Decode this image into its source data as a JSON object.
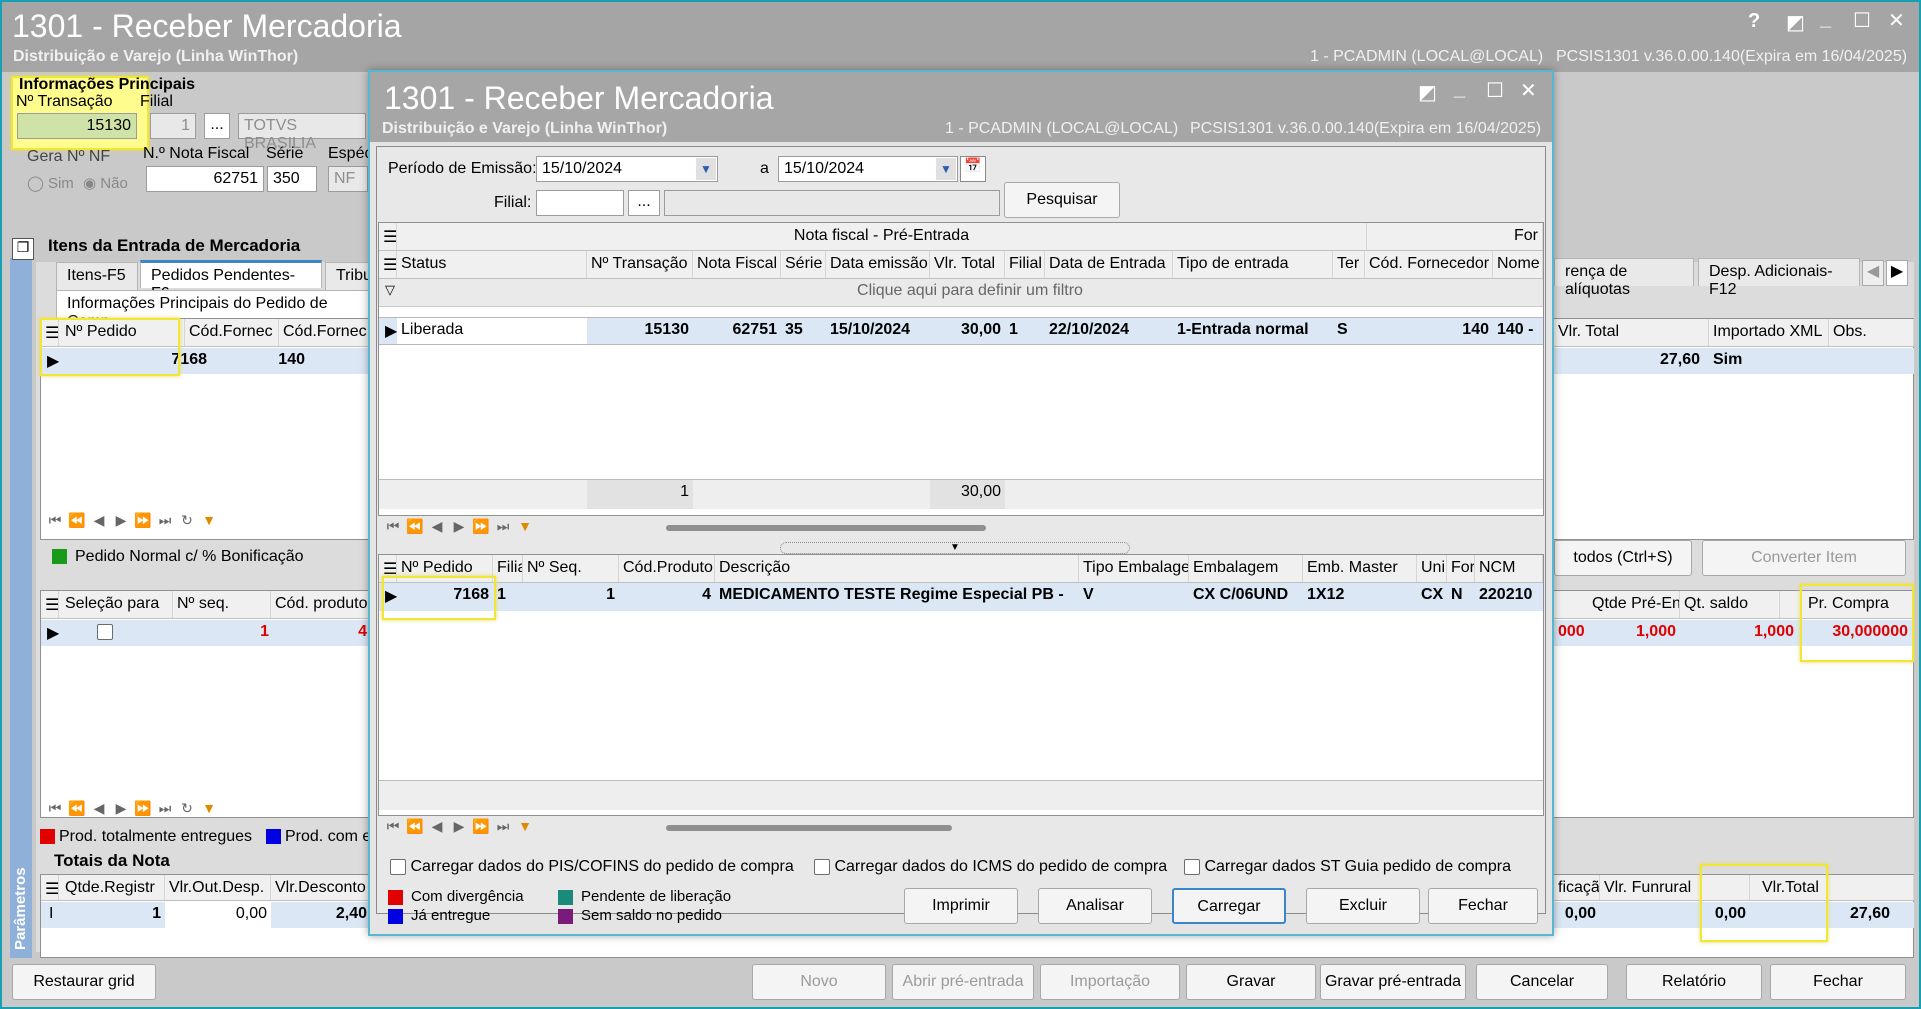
{
  "colors": {
    "highlight": "#fffc8e",
    "accent": "#57b7cf",
    "title_bg": "#a6a6a6",
    "selected_row": "#dbe7f5",
    "legend_divergence": "#e00000",
    "legend_delivered": "#0000e0",
    "legend_pending": "#1a8a7a",
    "legend_no_balance": "#7a1a7a",
    "legend_normal_bonus": "#1a9a1a"
  },
  "bg": {
    "title": "1301 - Receber Mercadoria",
    "subtitle": "Distribuição e Varejo (Linha WinThor)",
    "user_info": "1 - PCADMIN (LOCAL@LOCAL)",
    "version_info": "PCSIS1301  v.36.0.00.140(Expira em 16/04/2025)",
    "ctrl_help": "?",
    "ctrl_min": "_",
    "ctrl_max": "☐",
    "ctrl_close": "✕",
    "info_section": {
      "title": "Informações Principais",
      "label_transacao": "Nº Transação",
      "label_filial": "Filial",
      "value_transacao": "15130",
      "value_filial": "1",
      "value_filial_name": "TOTVS BRASILIA",
      "label_gera_nf": "Gera Nº NF",
      "label_sim": "Sim",
      "label_nao": "Não",
      "label_nota_fiscal": "N.º Nota Fiscal",
      "label_serie": "Série",
      "label_especie": "Espéc",
      "value_nota_fiscal": "62751",
      "value_serie": "350",
      "value_especie": "NF",
      "browse": "..."
    },
    "items_title": "Itens da Entrada de Mercadoria",
    "tabs": [
      "Itens-F5",
      "Pedidos Pendentes-F6",
      "Tribu",
      "rença de alíquotas",
      "Desp. Adicionais-F12"
    ],
    "subtab": "Informações Principais do Pedido de Comp",
    "pedido_grid": {
      "headers": [
        "Nº Pedido",
        "Cód.Fornec",
        "Cód.Fornec.P"
      ],
      "row": [
        "7168",
        "140",
        ""
      ],
      "right_headers": [
        "Vlr. Total",
        "Importado XML",
        "Obs."
      ],
      "right_row": [
        "27,60",
        "Sim",
        ""
      ]
    },
    "legend_normal": "Pedido Normal c/ % Bonificação",
    "btn_select_all": "todos (Ctrl+S)",
    "btn_convert": "Converter Item",
    "items_grid": {
      "headers": [
        "Seleção para",
        "Nº seq.",
        "Cód. produto"
      ],
      "row_seq": "1",
      "row_prod": "4",
      "right_headers": [
        "Qtde Pré-En",
        "Qt. saldo",
        "Pr. Compra"
      ],
      "right_row": [
        "000",
        "1,000",
        "1,000",
        "30,000000"
      ]
    },
    "legend_delivered_total": "Prod. totalmente entregues",
    "legend_prod_com": "Prod. com e",
    "totals_title": "Totais da Nota",
    "totals_headers": [
      "Qtde.Registr",
      "Vlr.Out.Desp.",
      "Vlr.Desconto"
    ],
    "totals_row": [
      "1",
      "0,00",
      "2,40"
    ],
    "totals_right_headers": [
      "ficaçã",
      "Vlr. Funrural",
      "Vlr.Total"
    ],
    "totals_right_row": [
      "0,00",
      "0,00",
      "27,60"
    ],
    "side_label": "Parâmetros",
    "bottom_buttons": {
      "restaurar": "Restaurar grid",
      "novo": "Novo",
      "abrir": "Abrir pré-entrada",
      "importacao": "Importação",
      "gravar": "Gravar",
      "gravar_pre": "Gravar pré-entrada",
      "cancelar": "Cancelar",
      "relatorio": "Relatório",
      "fechar": "Fechar"
    }
  },
  "modal": {
    "title": "1301 - Receber Mercadoria",
    "subtitle": "Distribuição e Varejo (Linha WinThor)",
    "user_info": "1 - PCADMIN (LOCAL@LOCAL)",
    "version_info": "PCSIS1301  v.36.0.00.140(Expira em 16/04/2025)",
    "ctrl_min": "_",
    "ctrl_max": "☐",
    "ctrl_close": "✕",
    "periodo_label": "Período de Emissão:",
    "date_from": "15/10/2024",
    "date_sep": "a",
    "date_to": "15/10/2024",
    "filial_label": "Filial:",
    "browse": "...",
    "pesquisar": "Pesquisar",
    "band_main": "Nota fiscal - Pré-Entrada",
    "band_right": "For",
    "nf_headers": [
      "Status",
      "Nº Transação",
      "Nota Fiscal",
      "Série",
      "Data emissão",
      "Vlr. Total",
      "Filial",
      "Data de Entrada",
      "Tipo de entrada",
      "Ter",
      "Cód. Fornecedor",
      "Nome F"
    ],
    "filter_text": "Clique aqui para definir um filtro",
    "nf_row": [
      "Liberada",
      "15130",
      "62751",
      "35",
      "15/10/2024",
      "30,00",
      "1",
      "22/10/2024",
      "1-Entrada normal",
      "S",
      "140",
      "140 -"
    ],
    "nf_footer_count": "1",
    "nf_footer_total": "30,00",
    "item_headers": [
      "Nº Pedido",
      "Filia",
      "Nº Seq.",
      "Cód.Produto",
      "Descrição",
      "Tipo Embalage",
      "Embalagem",
      "Emb. Master",
      "Uni",
      "For",
      "NCM"
    ],
    "item_row": [
      "7168",
      "1",
      "1",
      "4",
      "MEDICAMENTO TESTE Regime Especial PB -",
      "V",
      "CX C/06UND",
      "1X12",
      "CX",
      "N",
      "220210"
    ],
    "chk_pis": "Carregar dados do PIS/COFINS do pedido de compra",
    "chk_icms": "Carregar dados do ICMS do pedido de compra",
    "chk_st": "Carregar dados ST Guia pedido de compra",
    "legend": {
      "divergence": "Com divergência",
      "delivered": "Já entregue",
      "pending": "Pendente de liberação",
      "no_balance": "Sem saldo no pedido"
    },
    "buttons": {
      "imprimir": "Imprimir",
      "analisar": "Analisar",
      "carregar": "Carregar",
      "excluir": "Excluir",
      "fechar": "Fechar"
    }
  }
}
